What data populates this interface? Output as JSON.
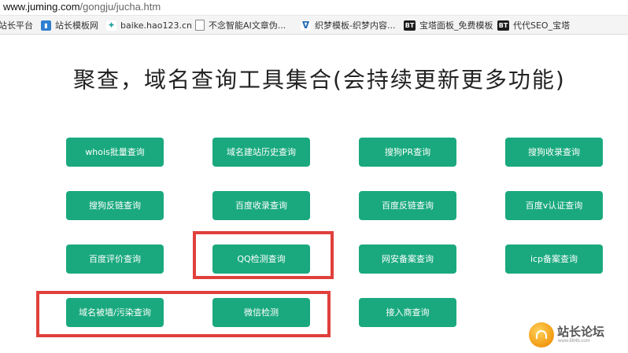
{
  "browser": {
    "url_host": "www.juming.com",
    "url_path": "/gongju/jucha.htm",
    "bookmarks": [
      {
        "label": "站长平台",
        "icon": "none"
      },
      {
        "label": "站长模板网",
        "icon": "bookmark-icon"
      },
      {
        "label": "baike.hao123.cn",
        "icon": "tag-icon"
      },
      {
        "label": "不念智能AI文章伪...",
        "icon": "page-icon"
      },
      {
        "label": "织梦模板-织梦内容...",
        "icon": "dede-icon"
      },
      {
        "label": "宝塔面板_免费模板",
        "icon": "bt-icon",
        "badge": "BT"
      },
      {
        "label": "代代SEO_宝塔",
        "icon": "bt-icon",
        "badge": "BT"
      }
    ]
  },
  "page": {
    "title": "聚查，域名查询工具集合(会持续更新更多功能)"
  },
  "tools": [
    {
      "label": "whois批量查询"
    },
    {
      "label": "域名建站历史查询"
    },
    {
      "label": "搜狗PR查询"
    },
    {
      "label": "搜狗收录查询"
    },
    {
      "label": "搜狗反链查询"
    },
    {
      "label": "百度收录查询"
    },
    {
      "label": "百度反链查询"
    },
    {
      "label": "百度v认证查询"
    },
    {
      "label": "百度评价查询"
    },
    {
      "label": "QQ检测查询"
    },
    {
      "label": "网安备案查询"
    },
    {
      "label": "icp备案查询"
    },
    {
      "label": "域名被墙/污染查询"
    },
    {
      "label": "微信检测"
    },
    {
      "label": "接入商查询"
    }
  ],
  "watermark": {
    "text": "站长论坛",
    "sub": "www.884b.com"
  },
  "colors": {
    "button_bg": "#1aa97e",
    "highlight_border": "#e0403c"
  }
}
